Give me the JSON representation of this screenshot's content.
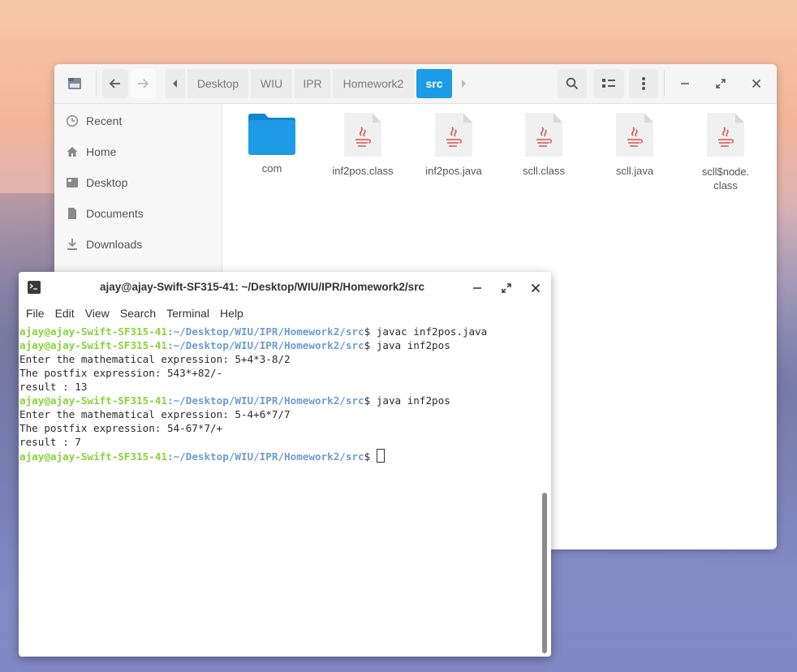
{
  "files": {
    "breadcrumb": [
      "Desktop",
      "WIU",
      "IPR",
      "Homework2",
      "src"
    ],
    "sidebar": [
      {
        "label": "Recent",
        "icon": "clock-icon"
      },
      {
        "label": "Home",
        "icon": "home-icon"
      },
      {
        "label": "Desktop",
        "icon": "desktop-icon"
      },
      {
        "label": "Documents",
        "icon": "document-icon"
      },
      {
        "label": "Downloads",
        "icon": "download-icon"
      }
    ],
    "items": [
      {
        "name": "com",
        "type": "folder"
      },
      {
        "name": "inf2pos.class",
        "type": "java-file"
      },
      {
        "name": "inf2pos.java",
        "type": "java-file"
      },
      {
        "name": "scll.class",
        "type": "java-file"
      },
      {
        "name": "scll.java",
        "type": "java-file"
      },
      {
        "name": "scll$node.\nclass",
        "type": "java-file"
      }
    ]
  },
  "terminal": {
    "title": "ajay@ajay-Swift-SF315-41: ~/Desktop/WIU/IPR/Homework2/src",
    "menu": [
      "File",
      "Edit",
      "View",
      "Search",
      "Terminal",
      "Help"
    ],
    "prompt_user": "ajay@ajay-Swift-SF315-41",
    "prompt_path": ":~/Desktop/WIU/IPR/Homework2/src",
    "lines": [
      {
        "kind": "prompt",
        "cmd": "$ javac inf2pos.java"
      },
      {
        "kind": "prompt",
        "cmd": "$ java inf2pos"
      },
      {
        "kind": "out",
        "text": "Enter the mathematical expression: 5+4*3-8/2"
      },
      {
        "kind": "out",
        "text": "The postfix expression: 543*+82/-"
      },
      {
        "kind": "out",
        "text": "result : 13"
      },
      {
        "kind": "prompt",
        "cmd": "$ java inf2pos"
      },
      {
        "kind": "out",
        "text": "Enter the mathematical expression: 5-4+6*7/7"
      },
      {
        "kind": "out",
        "text": "The postfix expression: 54-67*7/+"
      },
      {
        "kind": "out",
        "text": "result : 7"
      },
      {
        "kind": "prompt",
        "cmd": "$ "
      }
    ]
  },
  "colors": {
    "accent": "#1e9be6",
    "prompt_user": "#8ad23a",
    "prompt_path": "#6f9ccf",
    "java_icon": "#d9534f"
  }
}
